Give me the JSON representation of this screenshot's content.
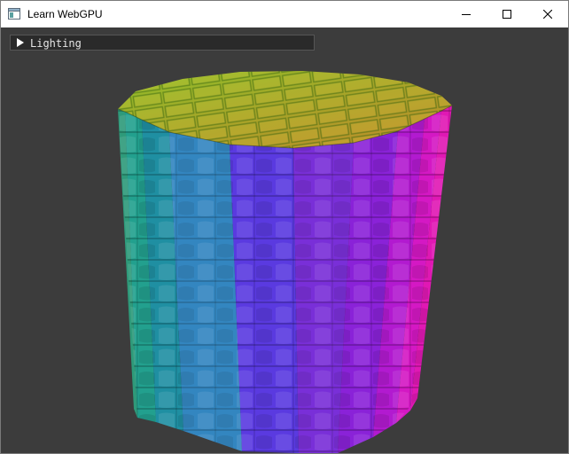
{
  "window": {
    "title": "Learn WebGPU",
    "controls": [
      "minimize-icon",
      "maximize-icon",
      "close-icon"
    ]
  },
  "gui": {
    "panel_label": "Lighting",
    "collapsed": true,
    "arrow_icon": "triangle-right-icon"
  },
  "scene": {
    "object": "textured cylinder (normal map visualization)",
    "background_color": "#3c3c3c"
  }
}
